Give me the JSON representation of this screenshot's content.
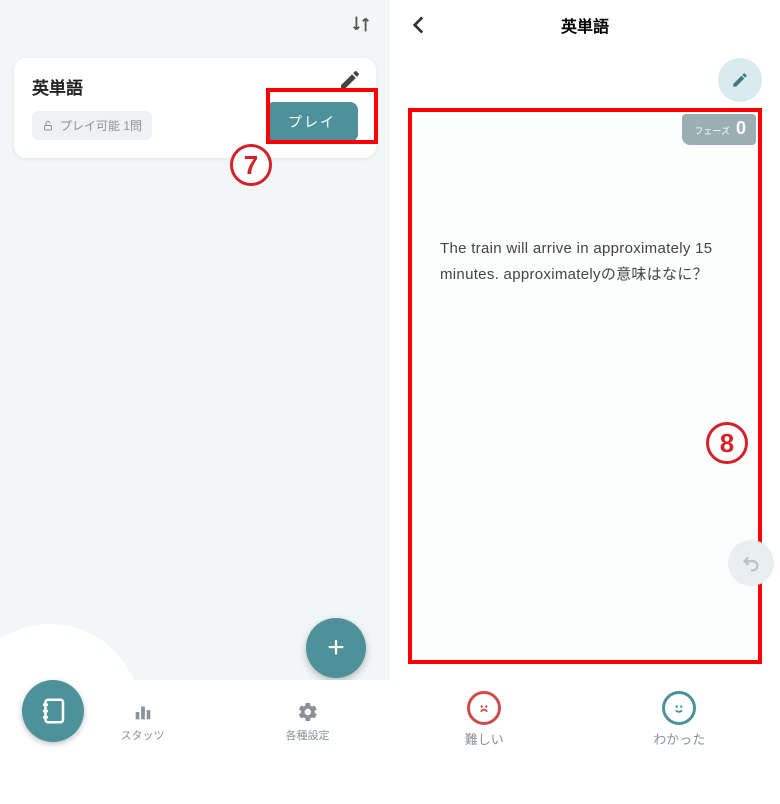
{
  "left": {
    "deck": {
      "title": "英単語",
      "badge": "プレイ可能 1問",
      "play_label": "プレイ"
    },
    "nav": {
      "stats": "スタッツ",
      "settings": "各種設定"
    },
    "callout": "7"
  },
  "right": {
    "title": "英単語",
    "phase_label": "フェーズ",
    "phase_value": "0",
    "question": "The train will arrive in approximately 15 minutes. approximatelyの意味はなに？",
    "answers": {
      "hard": "難しい",
      "ok": "わかった"
    },
    "callout": "8"
  }
}
